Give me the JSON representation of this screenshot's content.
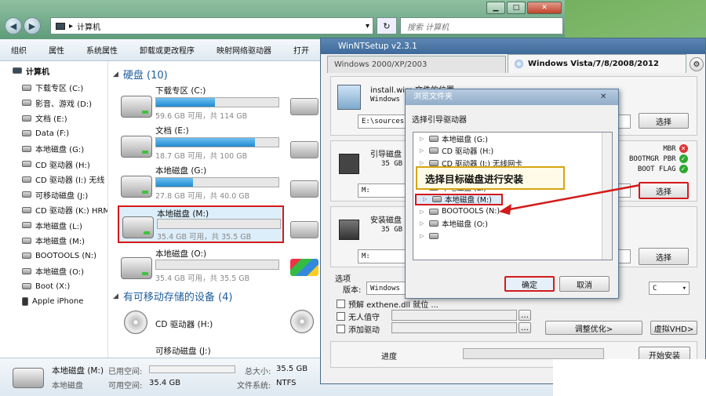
{
  "explorer": {
    "breadcrumb": "计算机",
    "search_placeholder": "搜索 计算机",
    "toolbar": [
      "组织",
      "属性",
      "系统属性",
      "卸载或更改程序",
      "映射网络驱动器",
      "打开"
    ],
    "sidebar": {
      "root": "计算机",
      "items": [
        "下载专区 (C:)",
        "影音、游戏 (D:)",
        "文档 (E:)",
        "Data (F:)",
        "本地磁盘 (G:)",
        "CD 驱动器 (H:)",
        "CD 驱动器 (I:) 无线",
        "可移动磁盘 (J:)",
        "CD 驱动器 (K:) HRM",
        "本地磁盘 (L:)",
        "本地磁盘 (M:)",
        "BOOTOOLS (N:)",
        "本地磁盘 (O:)",
        "Boot (X:)",
        "Apple iPhone"
      ]
    },
    "section_hdd": "硬盘 (10)",
    "drives": [
      {
        "name": "下载专区 (C:)",
        "detail": "59.6 GB 可用，共 114 GB",
        "used_fraction": 0.48
      },
      {
        "name": "文档 (E:)",
        "detail": "18.7 GB 可用，共 100 GB",
        "used_fraction": 0.81
      },
      {
        "name": "本地磁盘 (G:)",
        "detail": "27.8 GB 可用，共 40.0 GB",
        "used_fraction": 0.3
      },
      {
        "name": "本地磁盘 (M:)",
        "detail": "35.4 GB 可用，共 35.5 GB",
        "used_fraction": 0.0
      },
      {
        "name": "本地磁盘 (O:)",
        "detail": "35.4 GB 可用，共 35.5 GB",
        "used_fraction": 0.0
      }
    ],
    "section_removable": "有可移动存储的设备 (4)",
    "removable": [
      {
        "name": "CD 驱动器 (H:)"
      },
      {
        "name": "可移动磁盘 (J:)"
      }
    ],
    "status": {
      "name": "本地磁盘 (M:)",
      "type": "本地磁盘",
      "used_label": "已用空间:",
      "free_label": "可用空间:",
      "free_value": "35.4 GB",
      "total_label": "总大小:",
      "total_value": "35.5 GB",
      "fs_label": "文件系统:",
      "fs_value": "NTFS"
    }
  },
  "setup": {
    "title": "WinNTSetup v2.3.1",
    "tab1": "Windows 2000/XP/2003",
    "tab2": "Windows Vista/7/8/2008/2012",
    "install_label": "install.wim 文件的位置",
    "install_sub": "Windows",
    "install_path": "E:\\sources\\",
    "boot_label": "引导磁盘",
    "boot_sub": "35 GB",
    "boot_drive": "M:",
    "install_disk_label": "安装磁盘",
    "install_disk_sub": "35 GB",
    "install_disk_drive": "M:",
    "select": "选择",
    "flags": [
      {
        "text": "MBR",
        "ok": false
      },
      {
        "text": "BOOTMGR PBR",
        "ok": true
      },
      {
        "text": "BOOT FLAG",
        "ok": true
      }
    ],
    "options_label": "选项",
    "version_label": "版本:",
    "version_value": "Windows 8",
    "drive_letter": "C",
    "opt1": "预解 exthene.dll 就位 ...",
    "opt2": "无人值守",
    "opt3": "添加驱动",
    "tweaks": "调整优化>",
    "vhd": "虚拟VHD>",
    "progress_label": "进度",
    "start": "开始安装",
    "accent_red": "#d41a1a",
    "accent_green": "#2fa82f"
  },
  "browse": {
    "title": "浏览文件夹",
    "prompt": "选择引导驱动器",
    "tree": [
      "本地磁盘 (G:)",
      "CD 驱动器 (H:)",
      "CD 驱动器 (I:) 无线网卡",
      "",
      "本地磁盘 (L:)",
      "本地磁盘 (M:)",
      "BOOTOOLS (N:)",
      "本地磁盘 (O:)",
      ""
    ],
    "ok": "确定",
    "cancel": "取消"
  },
  "callout": "选择目标磁盘进行安装"
}
